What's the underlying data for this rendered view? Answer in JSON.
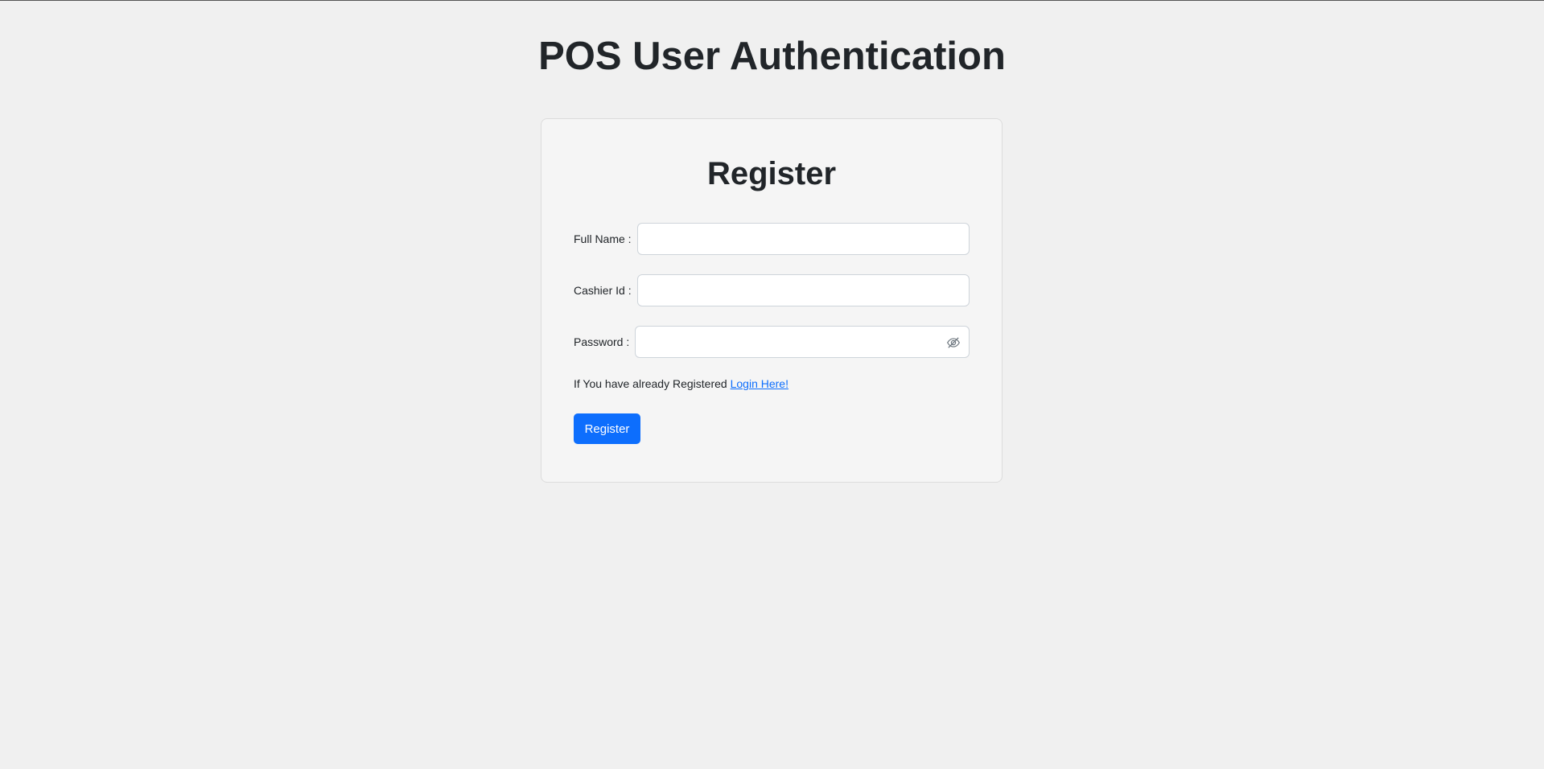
{
  "page": {
    "title": "POS User Authentication"
  },
  "form": {
    "title": "Register",
    "fields": [
      {
        "label": "Full Name :",
        "value": "",
        "type": "text"
      },
      {
        "label": "Cashier Id :",
        "value": "",
        "type": "text"
      },
      {
        "label": "Password :",
        "value": "",
        "type": "password",
        "toggle_icon": "eye-slash-icon"
      }
    ],
    "hint_text": "If You have already Registered",
    "login_link": "Login Here!",
    "submit_label": "Register"
  },
  "colors": {
    "background": "#f0f0f0",
    "card": "#f5f5f5",
    "primary": "#0d6efd",
    "text": "#212529"
  }
}
